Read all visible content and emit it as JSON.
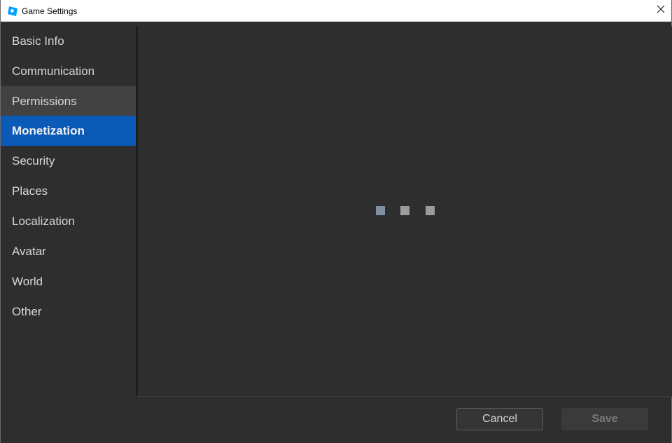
{
  "window": {
    "title": "Game Settings",
    "icon": "roblox-studio-icon",
    "close_icon": "close-icon"
  },
  "sidebar": {
    "items": [
      {
        "label": "Basic Info",
        "state": "normal"
      },
      {
        "label": "Communication",
        "state": "normal"
      },
      {
        "label": "Permissions",
        "state": "hover"
      },
      {
        "label": "Monetization",
        "state": "selected"
      },
      {
        "label": "Security",
        "state": "normal"
      },
      {
        "label": "Places",
        "state": "normal"
      },
      {
        "label": "Localization",
        "state": "normal"
      },
      {
        "label": "Avatar",
        "state": "normal"
      },
      {
        "label": "World",
        "state": "normal"
      },
      {
        "label": "Other",
        "state": "normal"
      }
    ]
  },
  "content": {
    "loading_indicator": "loading-dots-icon"
  },
  "footer": {
    "cancel_label": "Cancel",
    "save_label": "Save",
    "save_enabled": false
  },
  "colors": {
    "accent": "#0b5ab8",
    "background": "#2e2e2e",
    "hover": "#424242"
  }
}
